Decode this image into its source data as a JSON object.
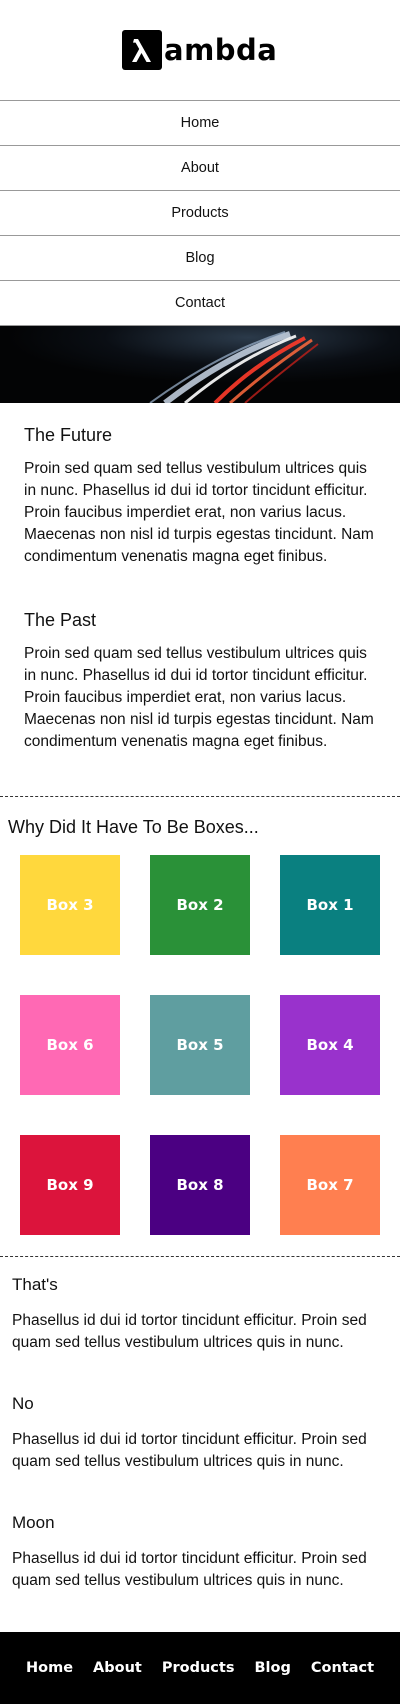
{
  "logo": {
    "text": "ambda",
    "icon": "lambda-icon"
  },
  "nav": {
    "items": [
      "Home",
      "About",
      "Products",
      "Blog",
      "Contact"
    ]
  },
  "articles": [
    {
      "title": "The Future",
      "body": "Proin sed quam sed tellus vestibulum ultrices quis in nunc. Phasellus id dui id tortor tincidunt efficitur. Proin faucibus imperdiet erat, non varius lacus. Maecenas non nisl id turpis egestas tincidunt. Nam condimentum venenatis magna eget finibus."
    },
    {
      "title": "The Past",
      "body": "Proin sed quam sed tellus vestibulum ultrices quis in nunc. Phasellus id dui id tortor tincidunt efficitur. Proin faucibus imperdiet erat, non varius lacus. Maecenas non nisl id turpis egestas tincidunt. Nam condimentum venenatis magna eget finibus."
    }
  ],
  "boxes": {
    "title": "Why Did It Have To Be Boxes...",
    "items": [
      {
        "label": "Box 3",
        "color": "#FFD83D"
      },
      {
        "label": "Box 2",
        "color": "#2A9138"
      },
      {
        "label": "Box 1",
        "color": "#0A8080"
      },
      {
        "label": "Box 6",
        "color": "#FF69B4"
      },
      {
        "label": "Box 5",
        "color": "#5F9EA0"
      },
      {
        "label": "Box 4",
        "color": "#9932CC"
      },
      {
        "label": "Box 9",
        "color": "#DC143C"
      },
      {
        "label": "Box 8",
        "color": "#4B0082"
      },
      {
        "label": "Box 7",
        "color": "#FF7F50"
      }
    ]
  },
  "sections": [
    {
      "title": "That's",
      "body": "Phasellus id dui id tortor tincidunt efficitur. Proin sed quam sed tellus vestibulum ultrices quis in nunc."
    },
    {
      "title": "No",
      "body": "Phasellus id dui id tortor tincidunt efficitur. Proin sed quam sed tellus vestibulum ultrices quis in nunc."
    },
    {
      "title": "Moon",
      "body": "Phasellus id dui id tortor tincidunt efficitur. Proin sed quam sed tellus vestibulum ultrices quis in nunc."
    }
  ],
  "footer": {
    "items": [
      "Home",
      "About",
      "Products",
      "Blog",
      "Contact"
    ]
  }
}
